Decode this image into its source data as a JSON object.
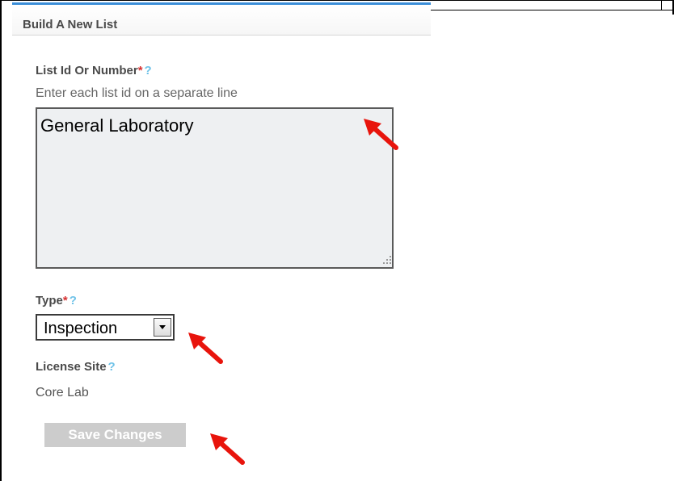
{
  "panel": {
    "title": "Build A New List"
  },
  "form": {
    "list_id": {
      "label": "List Id Or Number",
      "required_mark": "*",
      "help_mark": "?",
      "hint": "Enter each list id on a separate line",
      "value": "General Laboratory"
    },
    "type": {
      "label": "Type",
      "required_mark": "*",
      "help_mark": "?",
      "selected": "Inspection"
    },
    "license_site": {
      "label": "License Site",
      "help_mark": "?",
      "value": "Core Lab"
    },
    "save_label": "Save Changes"
  },
  "colors": {
    "accent_bar": "#3b8ed8",
    "annotation_arrow": "#e8140c",
    "required": "#d63030",
    "help": "#6fc2e8",
    "button_disabled": "#cccccc"
  },
  "annotations": {
    "arrow_count": 3
  }
}
